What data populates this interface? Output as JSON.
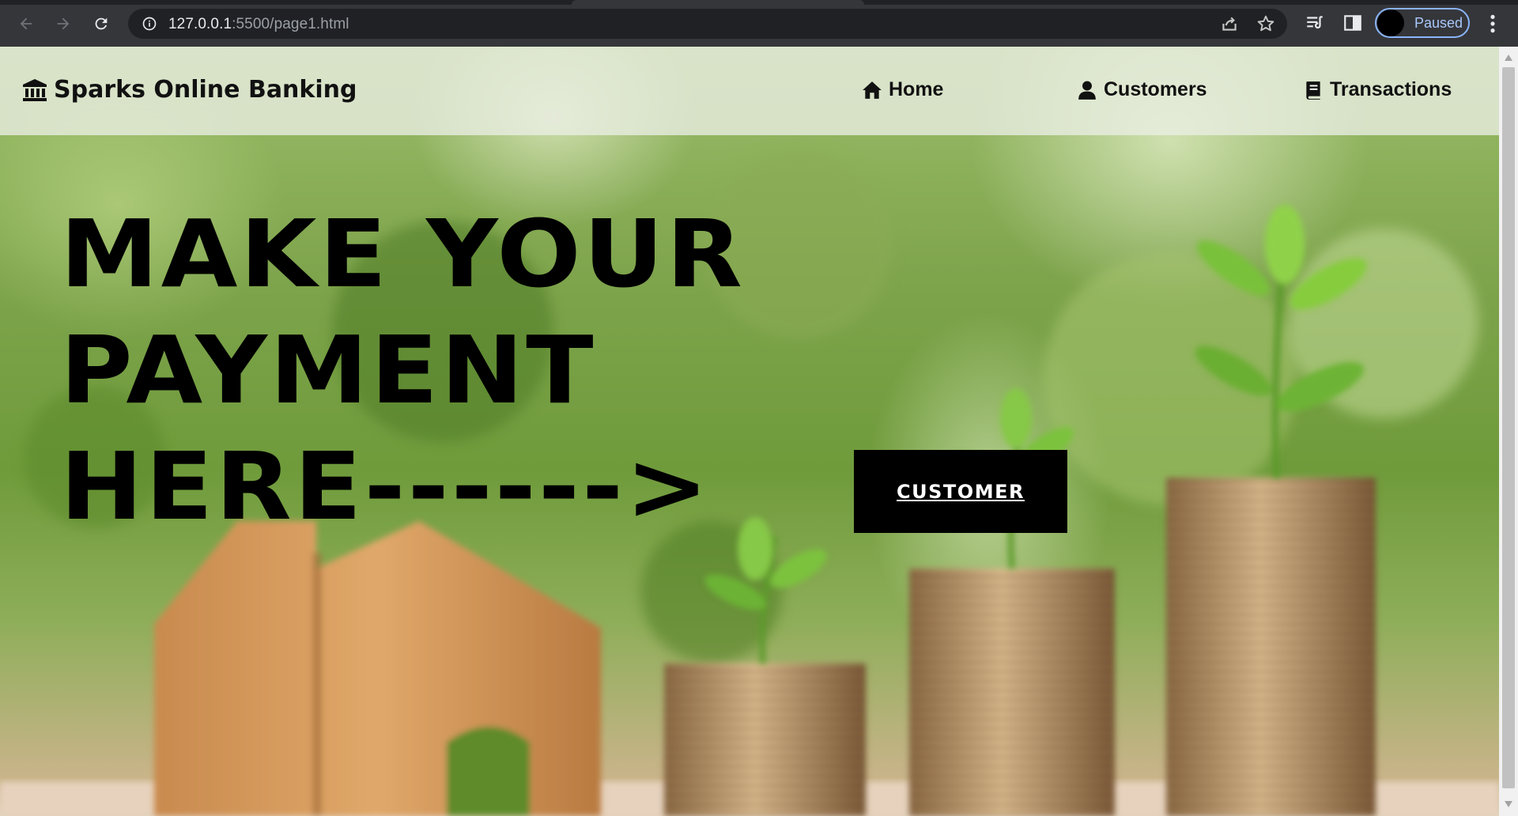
{
  "browser": {
    "url_host": "127.0.0.1",
    "url_rest": ":5500/page1.html",
    "profile_label": "Paused",
    "icons": [
      "back-arrow-icon",
      "forward-arrow-icon",
      "reload-icon",
      "info-icon",
      "share-icon",
      "star-icon",
      "reading-list-icon",
      "side-panel-icon",
      "kebab-menu-icon"
    ]
  },
  "navbar": {
    "brand_icon": "bank-icon",
    "brand": "Sparks Online Banking",
    "links": [
      {
        "label": "Home",
        "icon": "home-icon"
      },
      {
        "label": "Customers",
        "icon": "user-icon"
      },
      {
        "label": "Transactions",
        "icon": "book-icon"
      }
    ]
  },
  "hero": {
    "line1": "MAKE YOUR",
    "line2": "PAYMENT",
    "line3": "HERE------>",
    "cta": "CUSTOMER"
  },
  "colors": {
    "chrome_bg": "#35363a",
    "omnibox_bg": "#202124",
    "profile_accent": "#8ab4f8",
    "hero_text": "#000000",
    "cta_bg": "#000000",
    "cta_text": "#ffffff"
  }
}
